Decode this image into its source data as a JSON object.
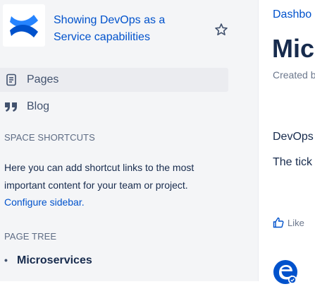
{
  "sidebar": {
    "space_name": "Showing DevOps as a Service capabilities",
    "nav": [
      {
        "label": "Pages",
        "icon": "page-icon",
        "active": true
      },
      {
        "label": "Blog",
        "icon": "quote-icon",
        "active": false
      }
    ],
    "shortcuts": {
      "heading": "SPACE SHORTCUTS",
      "description": "Here you can add shortcut links to the most important content for your team or project.",
      "configure_link": "Configure sidebar."
    },
    "page_tree": {
      "heading": "PAGE TREE",
      "items": [
        "Microservices"
      ]
    }
  },
  "main": {
    "breadcrumb": "Dashbo",
    "title": "Micr",
    "byline": "Created b",
    "paragraphs": [
      "DevOps",
      "The tick"
    ],
    "like_label": "Like"
  },
  "colors": {
    "link": "#0052cc",
    "sidebar_bg": "#f4f5f7",
    "active_bg": "#ebecf0",
    "text": "#172b4d",
    "muted": "#5e6c84"
  }
}
